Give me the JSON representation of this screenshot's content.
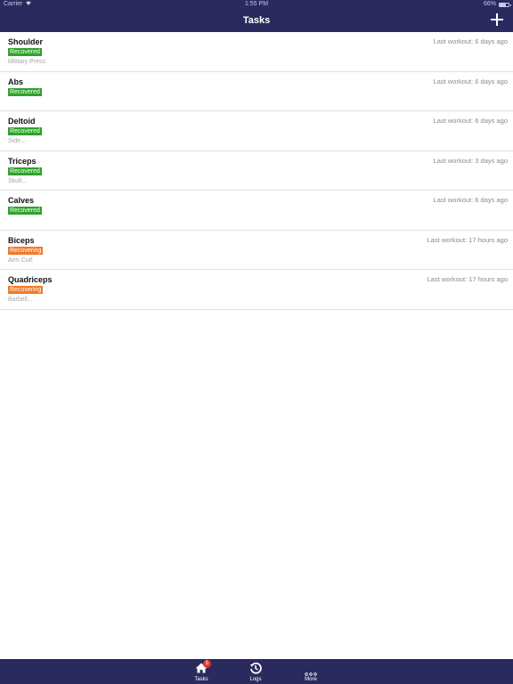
{
  "status_bar": {
    "carrier": "Carrier",
    "time": "1:55 PM",
    "battery_text": "66%",
    "battery_level": 0.66
  },
  "nav": {
    "title": "Tasks"
  },
  "tasks": [
    {
      "name": "Shoulder",
      "status": "Recovered",
      "status_type": "recovered",
      "last_workout": "Last workout: 6 days ago",
      "note": "Military Press"
    },
    {
      "name": "Abs",
      "status": "Recovered",
      "status_type": "recovered",
      "last_workout": "Last workout: 6 days ago",
      "note": ""
    },
    {
      "name": "Deltoid",
      "status": "Recovered",
      "status_type": "recovered",
      "last_workout": "Last workout: 6 days ago",
      "note": "Side..."
    },
    {
      "name": "Triceps",
      "status": "Recovered",
      "status_type": "recovered",
      "last_workout": "Last workout: 3 days ago",
      "note": "Skull..."
    },
    {
      "name": "Calves",
      "status": "Recovered",
      "status_type": "recovered",
      "last_workout": "Last workout: 6 days ago",
      "note": ""
    },
    {
      "name": "Biceps",
      "status": "Recovering",
      "status_type": "recovering",
      "last_workout": "Last workout: 17 hours ago",
      "note": "Arm Curl"
    },
    {
      "name": "Quadriceps",
      "status": "Recovering",
      "status_type": "recovering",
      "last_workout": "Last workout: 17 hours ago",
      "note": "Barbell..."
    }
  ],
  "tab_bar": {
    "tabs": [
      {
        "label": "Tasks",
        "icon": "home-icon",
        "badge": "5"
      },
      {
        "label": "Logs",
        "icon": "history-icon"
      },
      {
        "label": "More",
        "icon": "more-icon"
      }
    ]
  },
  "colors": {
    "bar_background": "#2b2a5e",
    "recovered": "#2fa32b",
    "recovering": "#f07a2a",
    "badge": "#e8352f"
  }
}
